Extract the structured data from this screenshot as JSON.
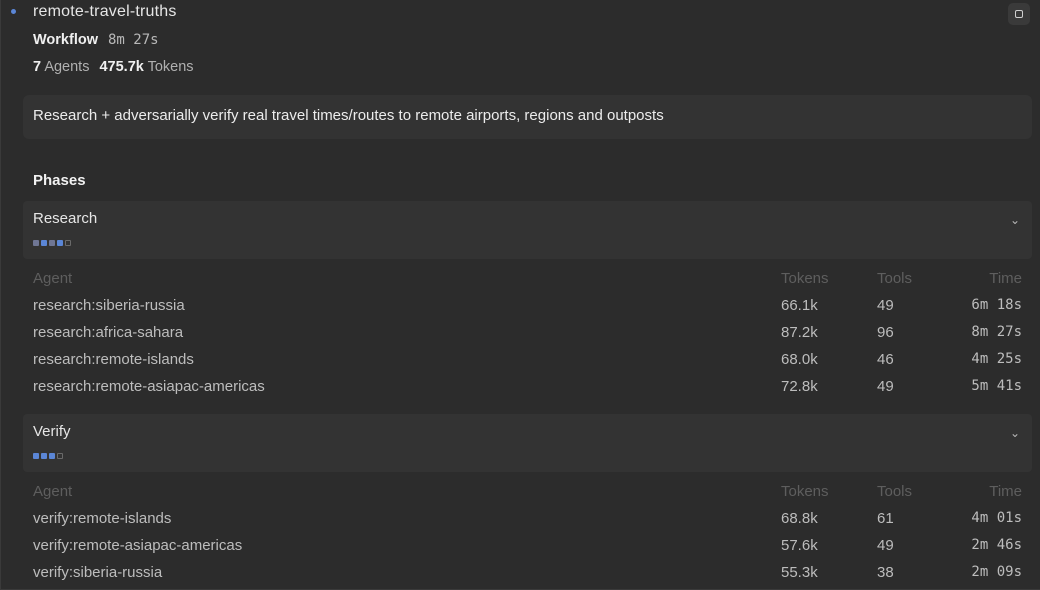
{
  "workflow": {
    "status_color": "#5b86d6",
    "name": "remote-travel-truths",
    "type_label": "Workflow",
    "elapsed": "8m 27s",
    "agents_count": "7",
    "agents_label": "Agents",
    "tokens_count": "475.7k",
    "tokens_label": "Tokens",
    "description": "Research + adversarially verify real travel times/routes to remote airports, regions and outposts"
  },
  "window_button": {
    "icon": "square-icon"
  },
  "phases_heading": "Phases",
  "table_headers": {
    "agent": "Agent",
    "tokens": "Tokens",
    "tools": "Tools",
    "time": "Time"
  },
  "phases": [
    {
      "name": "Research",
      "expanded": true,
      "progress": {
        "completed": 4,
        "total": 5
      },
      "agents": [
        {
          "agent": "research:siberia-russia",
          "tokens": "66.1k",
          "tools": "49",
          "time": "6m 18s"
        },
        {
          "agent": "research:africa-sahara",
          "tokens": "87.2k",
          "tools": "96",
          "time": "8m 27s"
        },
        {
          "agent": "research:remote-islands",
          "tokens": "68.0k",
          "tools": "46",
          "time": "4m 25s"
        },
        {
          "agent": "research:remote-asiapac-americas",
          "tokens": "72.8k",
          "tools": "49",
          "time": "5m 41s"
        }
      ]
    },
    {
      "name": "Verify",
      "expanded": true,
      "progress": {
        "completed": 3,
        "total": 4
      },
      "agents": [
        {
          "agent": "verify:remote-islands",
          "tokens": "68.8k",
          "tools": "61",
          "time": "4m 01s"
        },
        {
          "agent": "verify:remote-asiapac-americas",
          "tokens": "57.6k",
          "tools": "49",
          "time": "2m 46s"
        },
        {
          "agent": "verify:siberia-russia",
          "tokens": "55.3k",
          "tools": "38",
          "time": "2m 09s"
        }
      ]
    }
  ]
}
